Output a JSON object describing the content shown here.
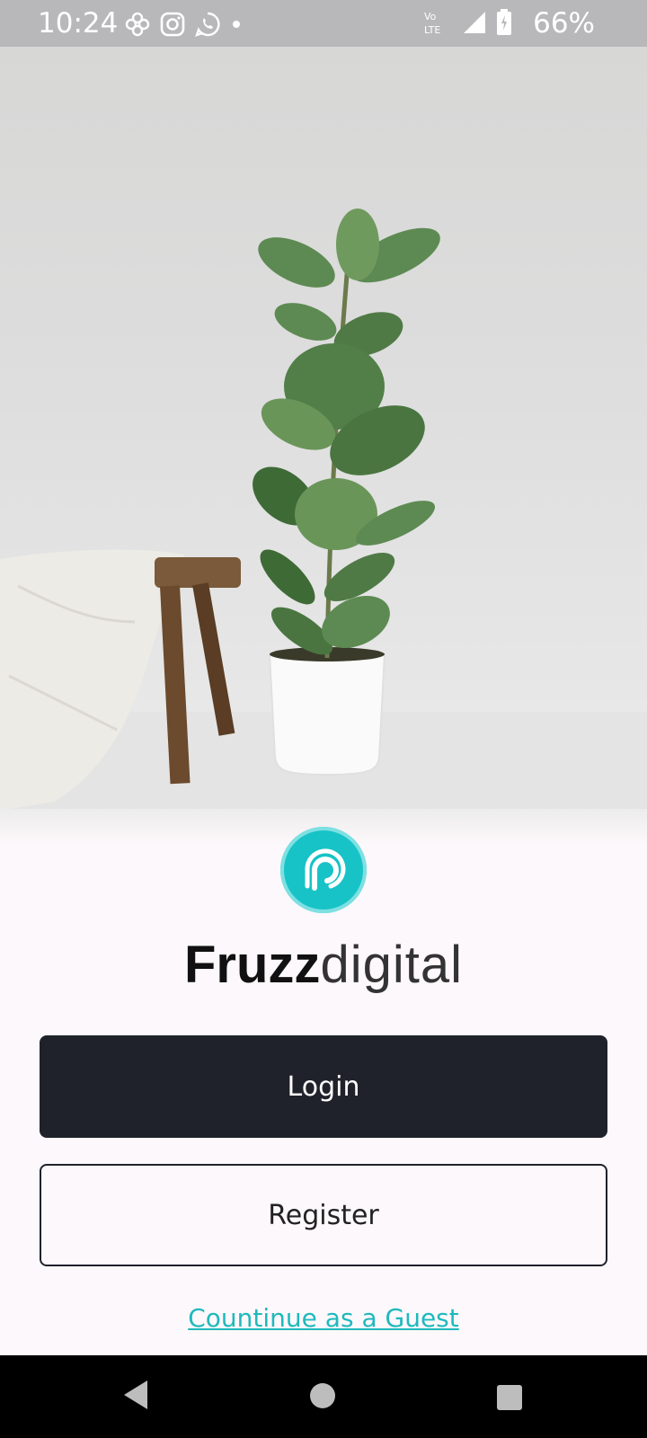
{
  "status_bar": {
    "time": "10:24",
    "battery": "66%",
    "left_icons": [
      "fan-icon",
      "instagram-icon",
      "whatsapp-icon",
      "dot-icon"
    ],
    "right_icons": [
      "volte-icon",
      "signal-icon",
      "battery-icon"
    ],
    "volte_label_top": "Vo",
    "volte_label_bottom": "LTE"
  },
  "brand": {
    "bold": "Fruzz",
    "light": "digital",
    "accent": "#17c3c6"
  },
  "buttons": {
    "login": "Login",
    "register": "Register"
  },
  "guest_link": "Countinue as a Guest",
  "colors": {
    "dark_button": "#20222b",
    "link": "#1fb9bd",
    "background": "#fdf8fb"
  }
}
